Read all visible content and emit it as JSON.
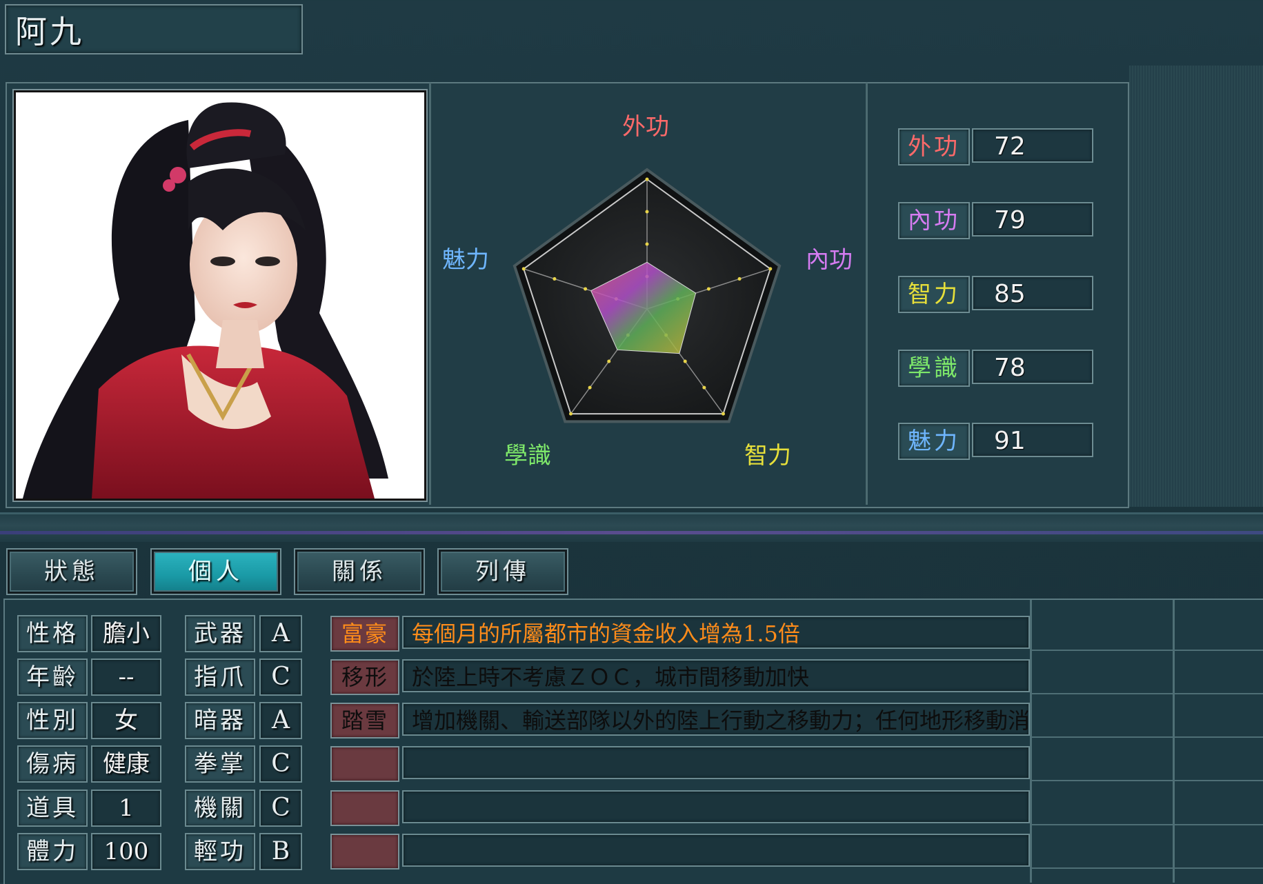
{
  "character": {
    "name": "阿九"
  },
  "radar": {
    "labels": {
      "external": "外功",
      "internal": "內功",
      "intellect": "智力",
      "knowledge": "學識",
      "charm": "魅力"
    },
    "max": 100
  },
  "stats": [
    {
      "label": "外功",
      "value": "72",
      "color": "#ff6a6a"
    },
    {
      "label": "內功",
      "value": "79",
      "color": "#d67cf2"
    },
    {
      "label": "智力",
      "value": "85",
      "color": "#e6df3a"
    },
    {
      "label": "學識",
      "value": "78",
      "color": "#7ee86a"
    },
    {
      "label": "魅力",
      "value": "91",
      "color": "#6fb6ff"
    }
  ],
  "tabs": [
    {
      "label": "狀態",
      "active": false
    },
    {
      "label": "個人",
      "active": true
    },
    {
      "label": "關係",
      "active": false
    },
    {
      "label": "列傳",
      "active": false
    }
  ],
  "profile": [
    {
      "label": "性格",
      "value": "膽小"
    },
    {
      "label": "年齡",
      "value": "--"
    },
    {
      "label": "性別",
      "value": "女"
    },
    {
      "label": "傷病",
      "value": "健康"
    },
    {
      "label": "道具",
      "value": "1"
    },
    {
      "label": "體力",
      "value": "100"
    }
  ],
  "skills": [
    {
      "label": "武器",
      "grade": "A"
    },
    {
      "label": "指爪",
      "grade": "C"
    },
    {
      "label": "暗器",
      "grade": "A"
    },
    {
      "label": "拳掌",
      "grade": "C"
    },
    {
      "label": "機關",
      "grade": "C"
    },
    {
      "label": "輕功",
      "grade": "B"
    }
  ],
  "traits": [
    {
      "tag": "富豪",
      "desc": "每個月的所屬都市的資金收入增為1.5倍",
      "color": "#ff8c1a"
    },
    {
      "tag": "移形",
      "desc": "於陸上時不考慮ＺＯＣ，城市間移動加快",
      "color": "#0d0d0d"
    },
    {
      "tag": "踏雪",
      "desc": "增加機關、輸送部隊以外的陸上行動之移動力；任何地形移動消耗相同",
      "color": "#0d0d0d"
    },
    {
      "tag": "",
      "desc": "",
      "color": "#0d0d0d"
    },
    {
      "tag": "",
      "desc": "",
      "color": "#0d0d0d"
    },
    {
      "tag": "",
      "desc": "",
      "color": "#0d0d0d"
    }
  ]
}
